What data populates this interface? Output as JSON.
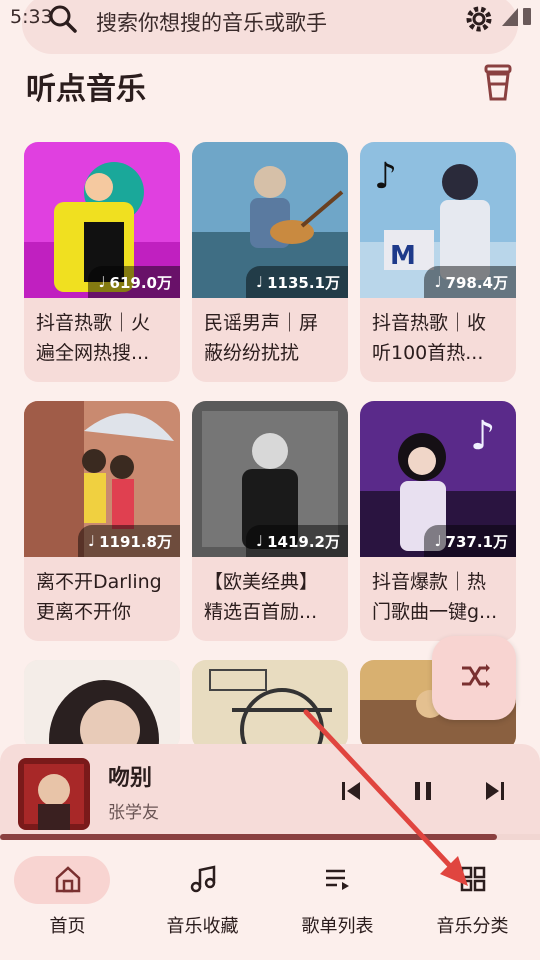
{
  "status": {
    "time": "5:33"
  },
  "search": {
    "placeholder": "搜索你想搜的音乐或歌手"
  },
  "header": {
    "title": "听点音乐"
  },
  "playlists": [
    {
      "title": "抖音热歌｜火遍全网热搜...",
      "plays": "619.0万"
    },
    {
      "title": "民谣男声｜屏蔽纷纷扰扰",
      "plays": "1135.1万"
    },
    {
      "title": "抖音热歌｜收听100首热...",
      "plays": "798.4万"
    },
    {
      "title": "离不开Darling更离不开你",
      "plays": "1191.8万"
    },
    {
      "title": "【欧美经典】精选百首励...",
      "plays": "1419.2万"
    },
    {
      "title": "抖音爆款｜热门歌曲一键g...",
      "plays": "737.1万"
    }
  ],
  "player": {
    "title": "吻别",
    "artist": "张学友",
    "progress": 0.92
  },
  "nav": [
    {
      "label": "首页",
      "active": true
    },
    {
      "label": "音乐收藏",
      "active": false
    },
    {
      "label": "歌单列表",
      "active": false
    },
    {
      "label": "音乐分类",
      "active": false
    }
  ],
  "colors": {
    "accent": "#8a4040",
    "background": "#fcefec",
    "card": "#f6dcd9",
    "arrow": "#e0453f"
  }
}
